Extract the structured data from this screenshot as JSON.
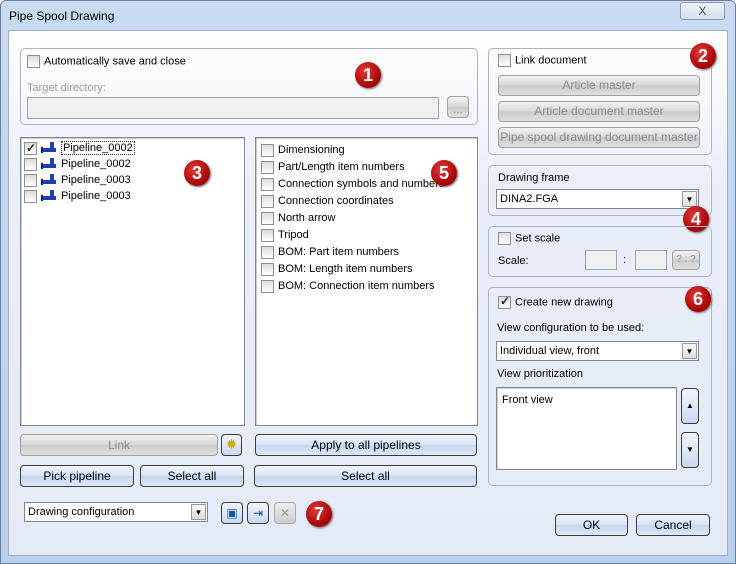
{
  "window": {
    "title": "Pipe Spool Drawing",
    "close_label": "X"
  },
  "group1": {
    "auto_save_label": "Automatically save and close",
    "auto_save_checked": false,
    "target_directory_label": "Target directory:",
    "target_directory_value": "",
    "browse_label": "...",
    "badge": "1"
  },
  "group2": {
    "link_document_label": "Link document",
    "link_document_checked": false,
    "article_master_label": "Article master",
    "article_document_master_label": "Article document master",
    "pipe_spool_master_label": "Pipe spool drawing document master",
    "badge": "2"
  },
  "pipelines": {
    "badge": "3",
    "items": [
      {
        "label": "Pipeline_0002",
        "checked": true,
        "selected": true
      },
      {
        "label": "Pipeline_0002",
        "checked": false
      },
      {
        "label": "Pipeline_0003",
        "checked": false
      },
      {
        "label": "Pipeline_0003",
        "checked": false
      }
    ]
  },
  "options": {
    "badge": "5",
    "items": [
      {
        "label": "Dimensioning"
      },
      {
        "label": "Part/Length item numbers"
      },
      {
        "label": "Connection symbols and numbers"
      },
      {
        "label": "Connection coordinates"
      },
      {
        "label": "North arrow"
      },
      {
        "label": "Tripod"
      },
      {
        "label": "BOM: Part item numbers"
      },
      {
        "label": "BOM: Length item numbers"
      },
      {
        "label": "BOM: Connection item numbers"
      }
    ]
  },
  "drawing_frame": {
    "label": "Drawing frame",
    "value": "DINA2.FGA",
    "badge": "4"
  },
  "scale": {
    "set_scale_label": "Set scale",
    "set_scale_checked": false,
    "scale_label": "Scale:",
    "separator": ":",
    "numerator": "",
    "denominator": "",
    "query_label": "? : ?"
  },
  "new_drawing": {
    "label": "Create new drawing",
    "checked": true,
    "view_config_label": "View configuration to be used:",
    "view_config_value": "Individual view, front",
    "prioritization_label": "View prioritization",
    "views": [
      "Front view"
    ],
    "badge": "6"
  },
  "buttons": {
    "link": "Link",
    "apply_all": "Apply to all pipelines",
    "pick_pipeline": "Pick pipeline",
    "select_all_pipelines": "Select all",
    "select_all_options": "Select all",
    "ok": "OK",
    "cancel": "Cancel"
  },
  "config": {
    "value": "Drawing configuration",
    "badge": "7"
  }
}
